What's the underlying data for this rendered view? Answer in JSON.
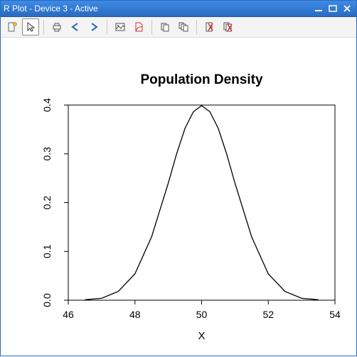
{
  "window": {
    "title": "R Plot - Device 3 - Active"
  },
  "toolbar": {
    "items": [
      {
        "name": "new-plot-icon"
      },
      {
        "name": "pointer-icon",
        "active": true
      },
      {
        "name": "sep"
      },
      {
        "name": "print-icon"
      },
      {
        "name": "back-arrow-icon"
      },
      {
        "name": "forward-arrow-icon"
      },
      {
        "name": "sep"
      },
      {
        "name": "export-image-icon"
      },
      {
        "name": "export-pdf-icon"
      },
      {
        "name": "sep"
      },
      {
        "name": "copy-icon"
      },
      {
        "name": "copy-multi-icon"
      },
      {
        "name": "sep"
      },
      {
        "name": "clear-icon"
      },
      {
        "name": "clear-all-icon"
      }
    ]
  },
  "chart_data": {
    "type": "line",
    "title": "Population Density",
    "xlabel": "X",
    "ylabel": "",
    "xlim": [
      46,
      54
    ],
    "ylim": [
      0.0,
      0.4
    ],
    "xticks": [
      46,
      48,
      50,
      52,
      54
    ],
    "yticks": [
      0.0,
      0.1,
      0.2,
      0.3,
      0.4
    ],
    "x": [
      46.5,
      47.0,
      47.5,
      48.0,
      48.5,
      49.0,
      49.25,
      49.5,
      49.75,
      50.0,
      50.25,
      50.5,
      50.75,
      51.0,
      51.5,
      52.0,
      52.5,
      53.0,
      53.5
    ],
    "values": [
      0.001,
      0.004,
      0.018,
      0.054,
      0.13,
      0.24,
      0.3,
      0.352,
      0.386,
      0.399,
      0.386,
      0.352,
      0.3,
      0.24,
      0.13,
      0.054,
      0.018,
      0.004,
      0.001
    ]
  }
}
